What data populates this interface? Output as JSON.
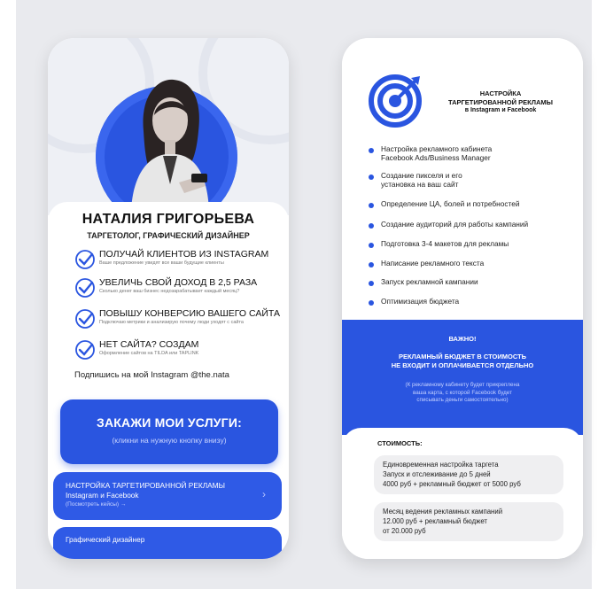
{
  "left_phone": {
    "name": "НАТАЛИЯ ГРИГОРЬЕВА",
    "role": "ТАРГЕТОЛОГ, ГРАФИЧЕСКИЙ ДИЗАЙНЕР",
    "benefits": [
      {
        "title": "ПОЛУЧАЙ КЛИЕНТОВ ИЗ INSTAGRAM",
        "subtitle": "Ваше предложение увидят все ваши будущие клиенты"
      },
      {
        "title": "УВЕЛИЧЬ СВОЙ ДОХОД В 2,5 РАЗА",
        "subtitle": "Сколько денег ваш бизнес недозарабатывает каждый месяц?"
      },
      {
        "title": "ПОВЫШУ КОНВЕРСИЮ ВАШЕГО САЙТА",
        "subtitle": "Подключаю метрики и анализирую почему люди уходят с сайта"
      },
      {
        "title": "НЕТ САЙТА? СОЗДАМ",
        "subtitle": "Оформление сайтов на TILDA или TAPLINK"
      }
    ],
    "subscribe": "Подпишись на мой Instagram @the.nata",
    "cta": {
      "title": "ЗАКАЖИ МОИ УСЛУГИ:",
      "subtitle": "(кликни на нужную кнопку внизу)"
    },
    "service_button": {
      "line1": "НАСТРОЙКА ТАРГЕТИРОВАННОЙ РЕКЛАМЫ",
      "line2": "Instagram и Facebook",
      "line3": "(Посмотреть кейсы) →",
      "chevron": "›"
    },
    "service_button2": {
      "line1": "Графический дизайнер"
    }
  },
  "right_phone": {
    "title_line1": "НАСТРОЙКА",
    "title_line2": "ТАРГЕТИРОВАННОЙ РЕКЛАМЫ",
    "title_line3": "в Instagram и Facebook",
    "bullets": [
      [
        "Настройка рекламного кабинета",
        "Facebook Ads/Business Manager"
      ],
      [
        "Создание пикселя и его",
        "установка на ваш сайт"
      ],
      [
        "Определение ЦА, болей и потребностей"
      ],
      [
        "Создание аудиторий для работы кампаний"
      ],
      [
        "Подготовка 3-4 макетов для рекламы"
      ],
      [
        "Написание рекламного текста"
      ],
      [
        "Запуск рекламной кампании"
      ],
      [
        "Оптимизация бюджета"
      ]
    ],
    "important": {
      "title": "ВАЖНО!",
      "text_line1": "РЕКЛАМНЫЙ БЮДЖЕТ В СТОИМОСТЬ",
      "text_line2": "НЕ ВХОДИТ И ОПЛАЧИВАЕТСЯ ОТДЕЛЬНО",
      "note_line1": "(К рекламному кабинету будет прикреплена",
      "note_line2": "ваша карта, с которой Facebook будет",
      "note_line3": "списывать деньги самостоятельно)"
    },
    "price_label": "СТОИМОСТЬ:",
    "price_boxes": [
      [
        "Единовременная настройка таргета",
        "Запуск и отслеживание до 5 дней",
        "4000 руб + рекламный бюджет от 5000 руб"
      ],
      [
        "Месяц ведения рекламных кампаний",
        "12.000 руб + рекламный бюджет",
        "от 20.000 руб"
      ]
    ]
  },
  "colors": {
    "accent": "#2a55e0",
    "background": "#e9eaee"
  }
}
